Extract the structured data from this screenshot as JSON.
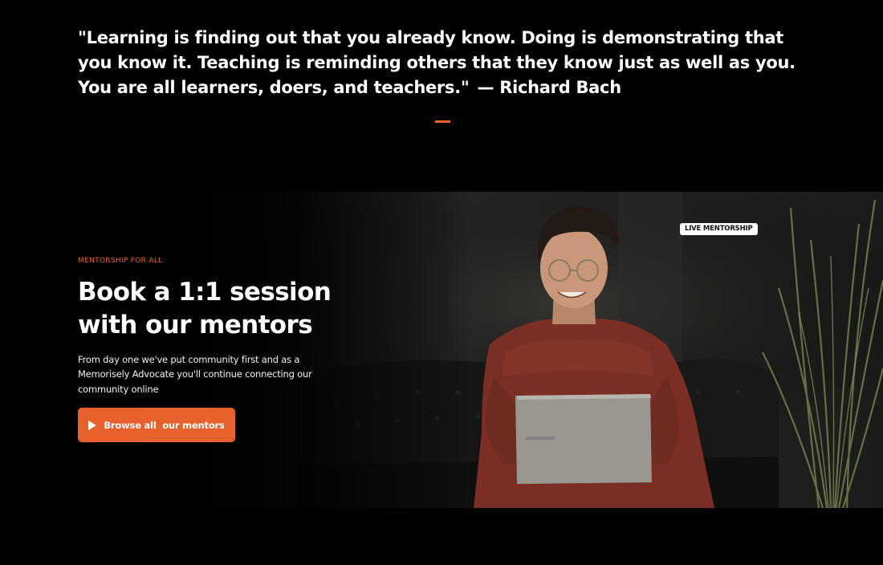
{
  "quote": {
    "text": "\"Learning is finding out that you already know. Doing is demonstrating that you know it. Teaching is reminding others that they know just as well as you. You are all learners, doers, and teachers.\"",
    "author": "— Richard Bach"
  },
  "hero": {
    "badge": "LIVE MENTORSHIP",
    "eyebrow": "MENTORSHIP FOR ALL",
    "headline": "Book a 1:1 session with our mentors",
    "description": "From day one we've put community first and as a Memorisely Advocate you'll continue connecting our community online",
    "cta_label": "Browse all  our mentors",
    "cta_icon": "play-icon"
  },
  "colors": {
    "accent": "#e8612c",
    "background": "#000000",
    "text": "#ffffff"
  }
}
